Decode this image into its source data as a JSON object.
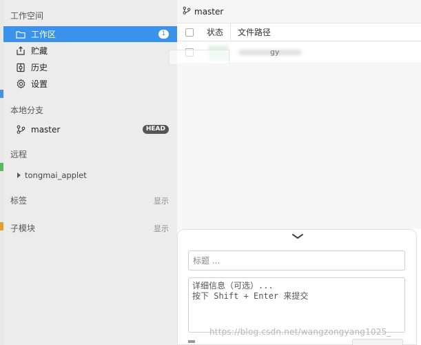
{
  "sidebar": {
    "workspace": {
      "title": "工作空间",
      "items": [
        {
          "label": "工作区",
          "icon": "folder-icon",
          "badge": "1",
          "active": true
        },
        {
          "label": "贮藏",
          "icon": "stash-icon"
        },
        {
          "label": "历史",
          "icon": "history-icon"
        },
        {
          "label": "设置",
          "icon": "gear-icon"
        }
      ]
    },
    "local_branches": {
      "title": "本地分支",
      "items": [
        {
          "label": "master",
          "icon": "branch-icon",
          "badge": "HEAD"
        }
      ]
    },
    "remotes": {
      "title": "远程",
      "items": [
        {
          "label": "tongmai_applet"
        }
      ]
    },
    "tags": {
      "title": "标签",
      "action": "显示"
    },
    "submodules": {
      "title": "子模块",
      "action": "显示"
    }
  },
  "main": {
    "branch": "master",
    "file_table": {
      "columns": [
        "状态",
        "文件路径"
      ],
      "rows": [
        {
          "name": "gy"
        }
      ]
    },
    "commit": {
      "title_placeholder": "标题 ...",
      "desc_placeholder": "详细信息（可选）...\n按下 Shift + Enter 来提交",
      "watermark": "https://blog.csdn.net/wangzongyang1025_"
    }
  },
  "colors": {
    "accent": "#3a92ea",
    "sidebar_bg": "#ececec"
  }
}
